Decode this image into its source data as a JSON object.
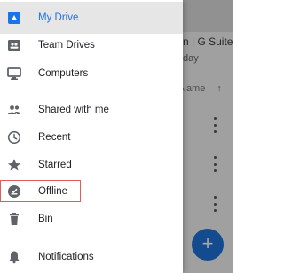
{
  "background": {
    "title_fragment": "n | G Suite effi",
    "subtitle_fragment": "day",
    "sort_label": "Name",
    "sort_arrow": "↑",
    "fab_icon": "+",
    "colors": {
      "fab": "#1e73d8"
    }
  },
  "drawer": {
    "items": [
      {
        "label": "My Drive",
        "icon": "drive-icon",
        "active": true
      },
      {
        "label": "Team Drives",
        "icon": "team-drives-icon"
      },
      {
        "label": "Computers",
        "icon": "computer-icon"
      },
      {
        "label": "Shared with me",
        "icon": "people-icon"
      },
      {
        "label": "Recent",
        "icon": "clock-icon"
      },
      {
        "label": "Starred",
        "icon": "star-icon"
      },
      {
        "label": "Offline",
        "icon": "offline-icon",
        "highlighted": true
      },
      {
        "label": "Bin",
        "icon": "trash-icon"
      },
      {
        "label": "Notifications",
        "icon": "bell-icon"
      }
    ],
    "colors": {
      "active_text": "#1a73e8",
      "active_icon": "#1a73e8",
      "icon": "#5f6368",
      "highlight_border": "#e25b5b"
    }
  }
}
